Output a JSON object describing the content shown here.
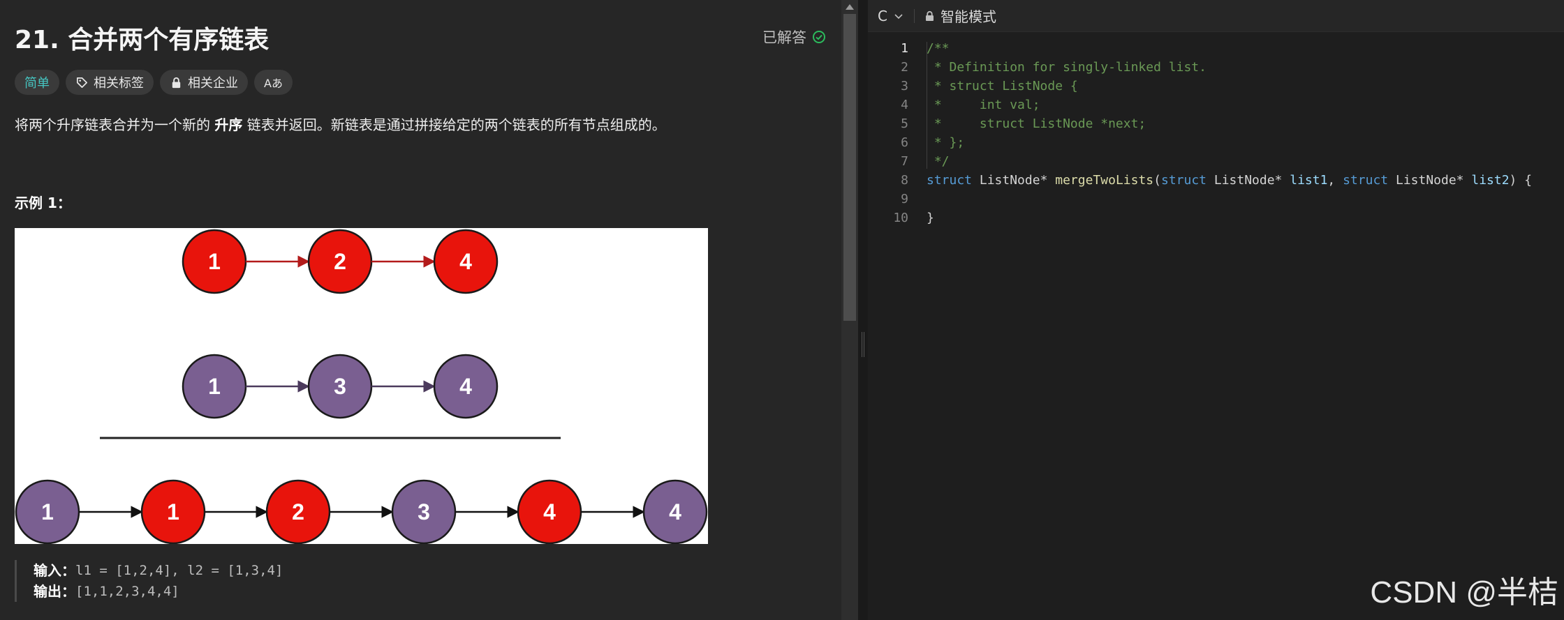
{
  "problem": {
    "title": "21. 合并两个有序链表",
    "status": "已解答",
    "tags": {
      "difficulty": "简单",
      "topics": "相关标签",
      "companies": "相关企业",
      "translate": "Aあ"
    },
    "description_before": "将两个升序链表合并为一个新的 ",
    "description_bold": "升序",
    "description_after": " 链表并返回。新链表是通过拼接给定的两个链表的所有节点组成的。",
    "example_heading": "示例 1：",
    "example": {
      "input_label": "输入：",
      "input_value": "l1 = [1,2,4], l2 = [1,3,4]",
      "output_label": "输出：",
      "output_value": "[1,1,2,3,4,4]"
    }
  },
  "diagram": {
    "list1": [
      "1",
      "2",
      "4"
    ],
    "list2": [
      "1",
      "3",
      "4"
    ],
    "merged": [
      "1",
      "1",
      "2",
      "3",
      "4",
      "4"
    ],
    "colors": {
      "red": "#e8140c",
      "purple": "#7a5f91",
      "red_arrow": "#b31b1b",
      "purple_arrow": "#4b3a5c"
    }
  },
  "editor": {
    "language": "C",
    "mode": "智能模式",
    "lines": [
      {
        "num": "1"
      },
      {
        "num": "2"
      },
      {
        "num": "3"
      },
      {
        "num": "4"
      },
      {
        "num": "5"
      },
      {
        "num": "6"
      },
      {
        "num": "7"
      },
      {
        "num": "8"
      },
      {
        "num": "9"
      },
      {
        "num": "10"
      }
    ],
    "code": {
      "l1": "/**",
      "l2": " * Definition for singly-linked list.",
      "l3": " * struct ListNode {",
      "l4": " *     int val;",
      "l5": " *     struct ListNode *next;",
      "l6": " * };",
      "l7": " */",
      "l8_kw1": "struct",
      "l8_t1": " ListNode* ",
      "l8_fn": "mergeTwoLists",
      "l8_p1": "(",
      "l8_kw2": "struct",
      "l8_t2": " ListNode* ",
      "l8_param1": "list1",
      "l8_c1": ", ",
      "l8_kw3": "struct",
      "l8_t3": " ListNode* ",
      "l8_param2": "list2",
      "l8_p2": ") {",
      "l10": "}"
    }
  },
  "watermark": "CSDN @半桔"
}
